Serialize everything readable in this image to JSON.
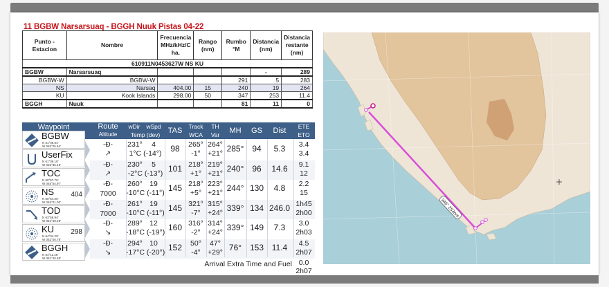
{
  "title": "11 BGBW Narsarsuaq - BGGH Nuuk  Pistas 04-22",
  "route_table": {
    "headers": [
      "Punto - Estacion",
      "Nombre",
      "Frecuencia MHz/kHz/C ha.",
      "Rango (nm)",
      "Rumbo °M",
      "Distancia (nm)",
      "Distancia restante (nm)"
    ],
    "route_string": "610911N0453627W  NS  KU",
    "departure": {
      "id": "BGBW",
      "name": "Narsarsuaq",
      "dist": "-",
      "remaining": "289"
    },
    "rows": [
      {
        "id": "BGBW-W",
        "name": "BGBW-W",
        "freq": "",
        "range": "",
        "course": "291",
        "dist": "5",
        "remaining": "283"
      },
      {
        "id": "NS",
        "name": "Narsaq",
        "freq": "404.00",
        "range": "15",
        "course": "240",
        "dist": "19",
        "remaining": "264"
      },
      {
        "id": "KU",
        "name": "Kook Islands",
        "freq": "298.00",
        "range": "50",
        "course": "347",
        "dist": "253",
        "remaining": "11.4"
      }
    ],
    "arrival": {
      "id": "BGGH",
      "name": "Nuuk",
      "course": "81",
      "dist": "11",
      "remaining": "0"
    }
  },
  "navlog": {
    "headers": {
      "waypoint": "Waypoint",
      "route": "Route",
      "altitude": "Altitude",
      "wdir": "wDir",
      "wspd": "wSpd",
      "temp": "Temp (dev)",
      "tas": "TAS",
      "track": "Track",
      "wca": "WCA",
      "th": "TH",
      "var": "Var",
      "mh": "MH",
      "gs": "GS",
      "dist": "Dist",
      "ete": "ETE",
      "eto": "ETO"
    },
    "waypoints": [
      {
        "name": "BGBW",
        "lat": "N 61°09.64'",
        "lon": "W 045°25.54'",
        "num": "",
        "icon": "airport-icon"
      },
      {
        "name": "UserFix",
        "lat": "N 61°09.18'",
        "lon": "W 045°36.45'",
        "num": "",
        "icon": "userfix-icon"
      },
      {
        "name": "TOC",
        "lat": "N 60°57.76'",
        "lon": "W 045°54.97'",
        "num": "",
        "icon": "toc-icon"
      },
      {
        "name": "NS",
        "lat": "N 60°54.00'",
        "lon": "W 046°01.00'",
        "num": "404",
        "icon": "ndb-icon"
      },
      {
        "name": "TOD",
        "lat": "N 63°58.94'",
        "lon": "W 051°49.29'",
        "num": "",
        "icon": "tod-icon"
      },
      {
        "name": "KU",
        "lat": "N 64°04.20'",
        "lon": "W 052°00.78'",
        "num": "298",
        "icon": "ndb-icon"
      },
      {
        "name": "BGGH",
        "lat": "N 64°11.46'",
        "lon": "W 051°40.68'",
        "num": "",
        "icon": "airport-icon"
      }
    ],
    "legs": [
      {
        "alt": "",
        "wdir": "231°",
        "wspd": "4",
        "temp": "1°C (-14°)",
        "tas": "98",
        "track": "265°",
        "wca": "-1°",
        "th": "264°",
        "var": "+21°",
        "mh": "285°",
        "gs": "94",
        "dist": "5.3",
        "ete": "3.4",
        "eto": "3.4",
        "climb": "climb"
      },
      {
        "alt": "",
        "wdir": "230°",
        "wspd": "5",
        "temp": "-2°C (-13°)",
        "tas": "101",
        "track": "218°",
        "wca": "+1°",
        "th": "219°",
        "var": "+21°",
        "mh": "240°",
        "gs": "96",
        "dist": "14.6",
        "ete": "9.1",
        "eto": "12",
        "climb": "climb"
      },
      {
        "alt": "7000",
        "wdir": "260°",
        "wspd": "19",
        "temp": "-10°C (-11°)",
        "tas": "145",
        "track": "218°",
        "wca": "+5°",
        "th": "223°",
        "var": "+21°",
        "mh": "244°",
        "gs": "130",
        "dist": "4.8",
        "ete": "2.2",
        "eto": "15",
        "climb": "level"
      },
      {
        "alt": "7000",
        "wdir": "261°",
        "wspd": "19",
        "temp": "-10°C (-11°)",
        "tas": "145",
        "track": "321°",
        "wca": "-7°",
        "th": "315°",
        "var": "+24°",
        "mh": "339°",
        "gs": "134",
        "dist": "246.0",
        "ete": "1h45",
        "eto": "2h00",
        "climb": "level"
      },
      {
        "alt": "",
        "wdir": "289°",
        "wspd": "12",
        "temp": "-18°C (-19°)",
        "tas": "160",
        "track": "316°",
        "wca": "-2°",
        "th": "314°",
        "var": "+24°",
        "mh": "339°",
        "gs": "149",
        "dist": "7.3",
        "ete": "3.0",
        "eto": "2h03",
        "climb": "descent"
      },
      {
        "alt": "",
        "wdir": "294°",
        "wspd": "10",
        "temp": "-17°C (-20°)",
        "tas": "152",
        "track": "50°",
        "wca": "-4°",
        "th": "47°",
        "var": "+29°",
        "mh": "76°",
        "gs": "153",
        "dist": "11.4",
        "ete": "4.5",
        "eto": "2h07",
        "climb": "descent"
      }
    ],
    "footer": {
      "label": "Arrival Extra Time and Fuel",
      "ete": "0.0",
      "eto": "2h07"
    }
  },
  "map": {
    "leg_label": "346° 253nm",
    "colors": {
      "sea": "#a9cfd8",
      "land": "#f1e9dc",
      "highland": "#e3c8a2",
      "ice": "#d9ac7c",
      "route": "#d84fd8"
    }
  }
}
